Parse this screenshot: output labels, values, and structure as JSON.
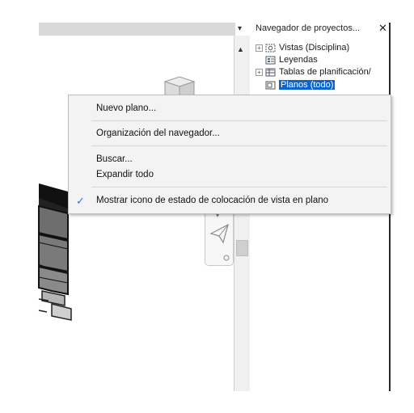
{
  "browser": {
    "title": "Navegador de proyectos...",
    "close_label": "✕",
    "items": [
      {
        "label": "Vistas (Disciplina)",
        "expander": "+"
      },
      {
        "label": "Leyendas",
        "expander": ""
      },
      {
        "label": "Tablas de planificación/",
        "expander": "+"
      },
      {
        "label": "Planos (todo)",
        "expander": "",
        "selected": true
      }
    ]
  },
  "context_menu": {
    "items": [
      {
        "label": "Nuevo plano..."
      },
      {
        "label": "Organización del navegador..."
      },
      {
        "label": "Buscar..."
      },
      {
        "label": "Expandir todo"
      },
      {
        "label": "Mostrar icono de estado de colocación de vista en plano",
        "checked": true
      }
    ],
    "check_mark": "✓"
  },
  "glyphs": {
    "dropdown": "▾",
    "scroll_up": "▲"
  },
  "colors": {
    "selection": "#0a64d2",
    "check": "#2a7ad8",
    "menu_bg": "#f3f3f3"
  }
}
